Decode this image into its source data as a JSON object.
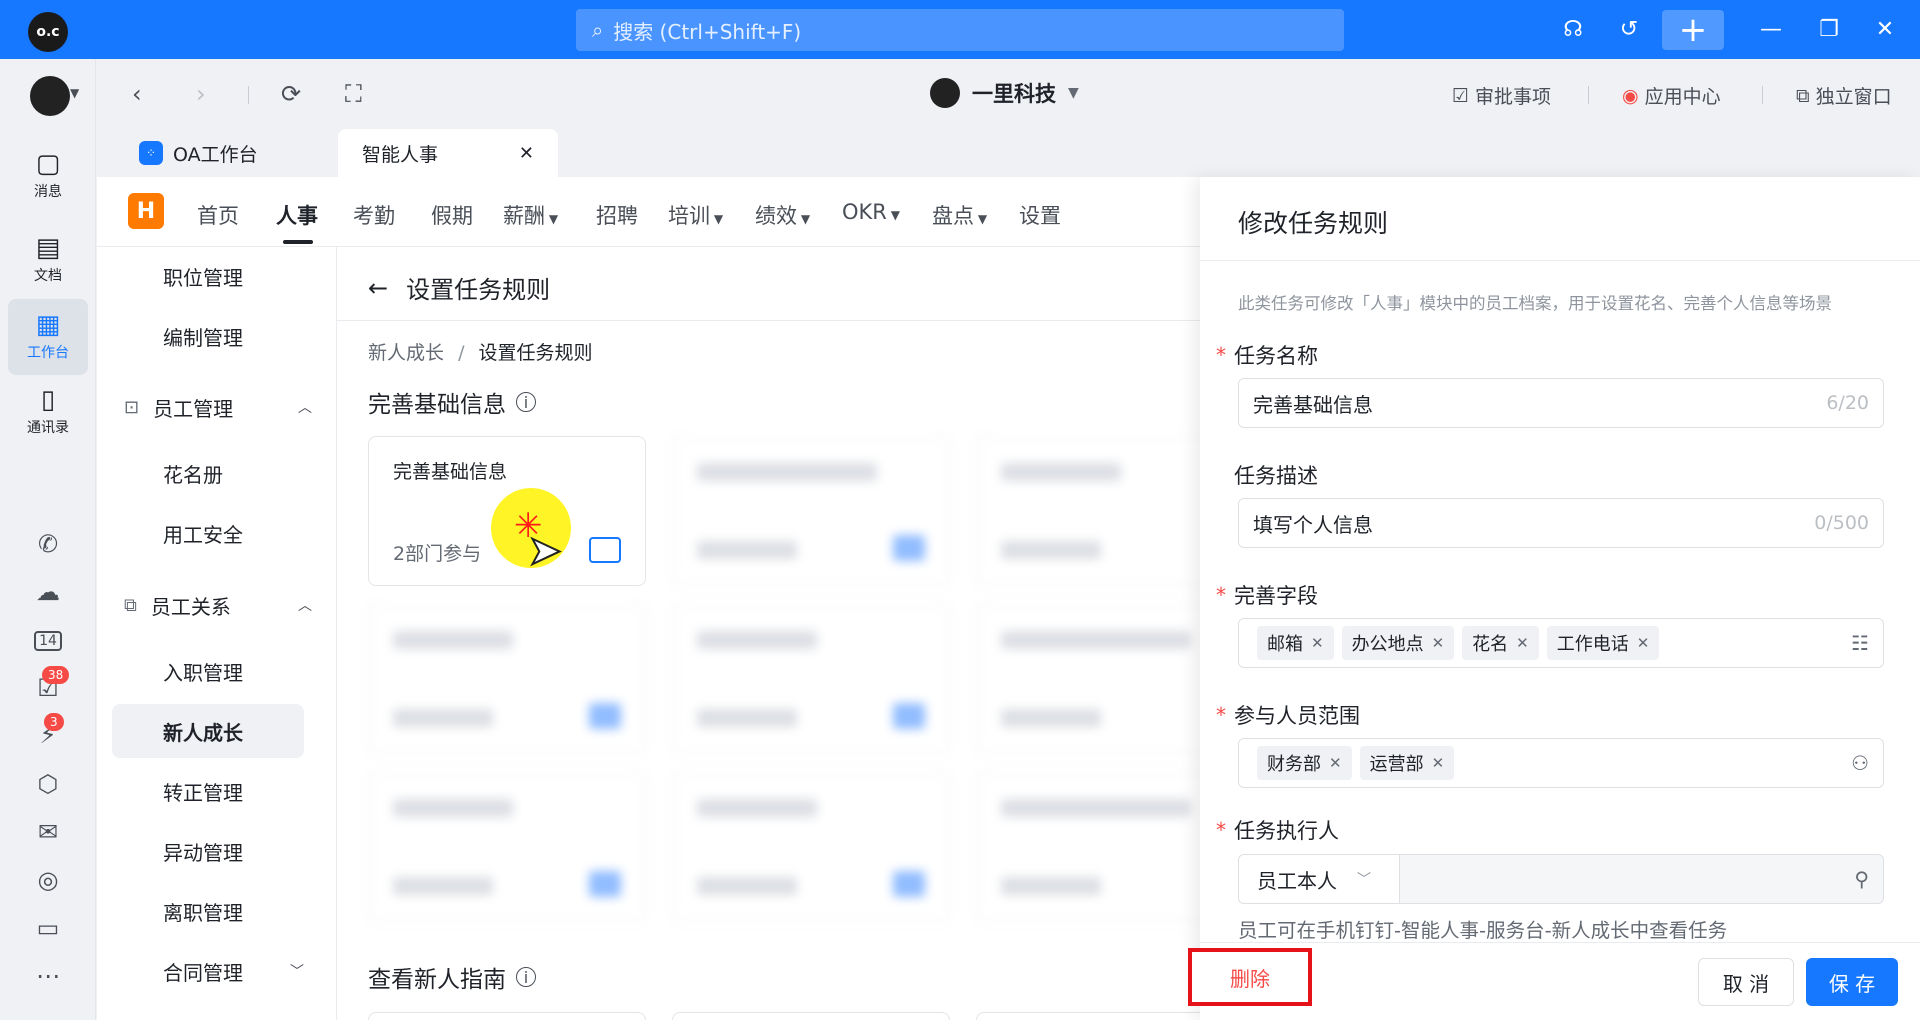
{
  "titlebar": {
    "search_placeholder": "搜索 (Ctrl+Shift+F)",
    "add_label": "+",
    "icons": [
      "headset-icon",
      "history-icon",
      "add-icon",
      "minimize-icon",
      "restore-icon",
      "close-icon"
    ]
  },
  "rail": {
    "items": [
      {
        "label": "消息",
        "icon": "message-icon"
      },
      {
        "label": "文档",
        "icon": "document-icon"
      },
      {
        "label": "工作台",
        "icon": "workbench-icon"
      },
      {
        "label": "通讯录",
        "icon": "contacts-icon"
      }
    ],
    "badges": {
      "todo": "38",
      "ding": "3"
    },
    "calendar_day": "14"
  },
  "navbar": {
    "org_name": "一里科技",
    "links": [
      {
        "label": "审批事项",
        "icon": "approval-icon"
      },
      {
        "label": "应用中心",
        "icon": "app-center-icon"
      },
      {
        "label": "独立窗口",
        "icon": "window-icon"
      }
    ]
  },
  "tabs": [
    {
      "label": "OA工作台"
    },
    {
      "label": "智能人事"
    }
  ],
  "module_menu": {
    "logo": "H",
    "items": [
      "首页",
      "人事",
      "考勤",
      "假期",
      "薪酬",
      "招聘",
      "培训",
      "绩效",
      "OKR",
      "盘点",
      "设置"
    ],
    "active": "人事"
  },
  "side_menu": {
    "items_top": [
      "职位管理",
      "编制管理"
    ],
    "group1": {
      "label": "员工管理",
      "items": [
        "花名册",
        "用工安全"
      ]
    },
    "group2": {
      "label": "员工关系",
      "items": [
        "入职管理",
        "新人成长",
        "转正管理",
        "异动管理",
        "离职管理",
        "合同管理"
      ]
    },
    "active": "新人成长"
  },
  "content": {
    "title": "设置任务规则",
    "breadcrumb": [
      "新人成长",
      "设置任务规则"
    ],
    "section1": "完善基础信息",
    "section2": "查看新人指南",
    "card": {
      "title": "完善基础信息",
      "subtitle": "2部门参与"
    }
  },
  "drawer": {
    "title": "修改任务规则",
    "hint": "此类任务可修改「人事」模块中的员工档案，用于设置花名、完善个人信息等场景",
    "task_name": {
      "label": "任务名称",
      "value": "完善基础信息",
      "count": "6/20"
    },
    "task_desc": {
      "label": "任务描述",
      "value": "填写个人信息",
      "count": "0/500"
    },
    "fields": {
      "label": "完善字段",
      "tags": [
        "邮箱",
        "办公地点",
        "花名",
        "工作电话"
      ]
    },
    "scope": {
      "label": "参与人员范围",
      "tags": [
        "财务部",
        "运营部"
      ]
    },
    "executor": {
      "label": "任务执行人",
      "value": "员工本人"
    },
    "executor_hint": "员工可在手机钉钉-智能人事-服务台-新人成长中查看任务",
    "buttons": {
      "delete": "删除",
      "cancel": "取 消",
      "save": "保 存"
    }
  },
  "colors": {
    "primary": "#1677ff",
    "danger": "#f54a45",
    "highlight": "#fff200"
  }
}
